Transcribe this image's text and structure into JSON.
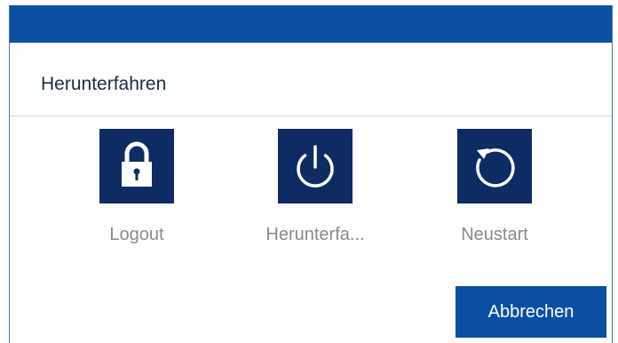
{
  "dialog": {
    "title": "Herunterfahren"
  },
  "options": [
    {
      "label": "Logout",
      "icon": "lock-icon"
    },
    {
      "label": "Herunterfa...",
      "icon": "power-icon"
    },
    {
      "label": "Neustart",
      "icon": "restart-icon"
    }
  ],
  "buttons": {
    "cancel_label": "Abbrechen"
  },
  "colors": {
    "titlebar": "#0a4fa4",
    "tile": "#0d2c63",
    "button": "#0a4fa4",
    "label_gray": "#8a8a8a"
  }
}
